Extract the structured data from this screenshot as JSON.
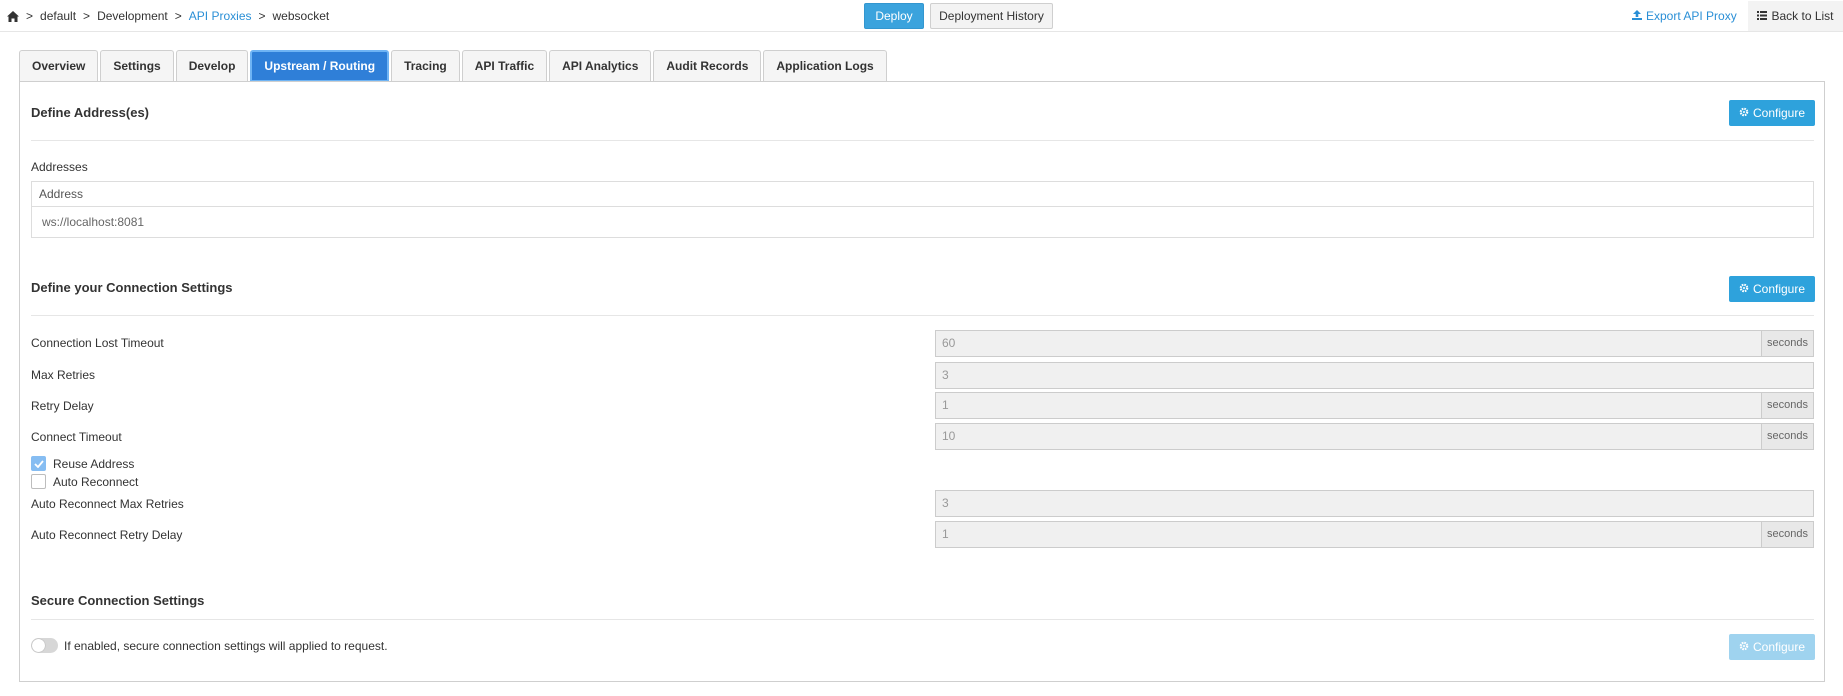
{
  "breadcrumb": {
    "items": [
      "default",
      "Development",
      "API Proxies",
      "websocket"
    ],
    "separator": ">"
  },
  "header": {
    "deploy_label": "Deploy",
    "history_label": "Deployment History",
    "export_label": "Export API Proxy",
    "back_label": "Back to List"
  },
  "tabs": [
    {
      "label": "Overview",
      "active": false
    },
    {
      "label": "Settings",
      "active": false
    },
    {
      "label": "Develop",
      "active": false
    },
    {
      "label": "Upstream / Routing",
      "active": true
    },
    {
      "label": "Tracing",
      "active": false
    },
    {
      "label": "API Traffic",
      "active": false
    },
    {
      "label": "API Analytics",
      "active": false
    },
    {
      "label": "Audit Records",
      "active": false
    },
    {
      "label": "Application Logs",
      "active": false
    }
  ],
  "addresses": {
    "title": "Define Address(es)",
    "configure_label": "Configure",
    "subtitle": "Addresses",
    "column_header": "Address",
    "rows": [
      "ws://localhost:8081"
    ]
  },
  "connection": {
    "title": "Define your Connection Settings",
    "configure_label": "Configure",
    "fields": [
      {
        "label": "Connection Lost Timeout",
        "value": "60",
        "unit": "seconds"
      },
      {
        "label": "Max Retries",
        "value": "3",
        "unit": ""
      },
      {
        "label": "Retry Delay",
        "value": "1",
        "unit": "seconds"
      },
      {
        "label": "Connect Timeout",
        "value": "10",
        "unit": "seconds"
      }
    ],
    "checkboxes": [
      {
        "label": "Reuse Address",
        "checked": true
      },
      {
        "label": "Auto Reconnect",
        "checked": false
      }
    ],
    "reconnect_fields": [
      {
        "label": "Auto Reconnect Max Retries",
        "value": "3",
        "unit": ""
      },
      {
        "label": "Auto Reconnect Retry Delay",
        "value": "1",
        "unit": "seconds"
      }
    ]
  },
  "secure": {
    "title": "Secure Connection Settings",
    "toggle_text": "If enabled, secure connection settings will applied to request.",
    "enabled": false,
    "configure_label": "Configure"
  },
  "colors": {
    "primary": "#2ea2dc",
    "active_tab": "#2f7fd8",
    "link": "#2a8fd6"
  }
}
